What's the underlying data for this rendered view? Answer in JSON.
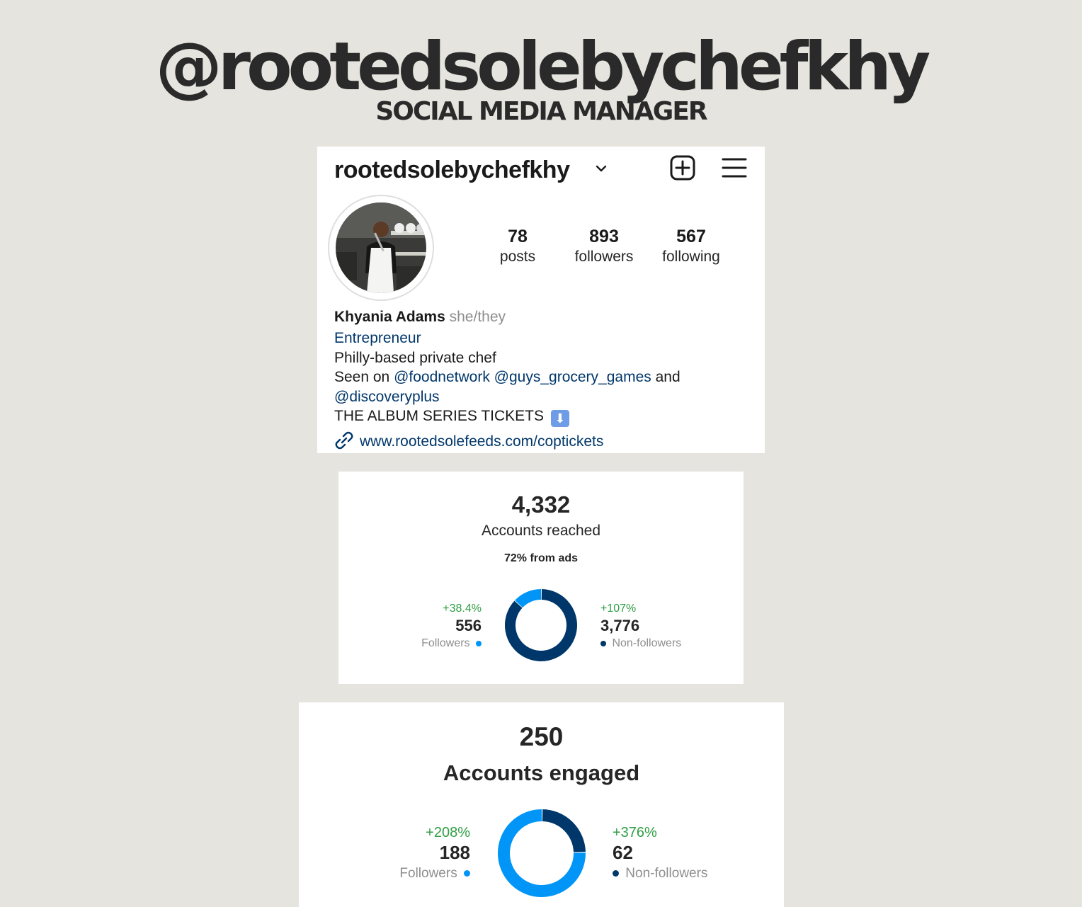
{
  "header": {
    "title": "@rootedsolebychefkhy",
    "subtitle": "SOCIAL MEDIA MANAGER"
  },
  "profile": {
    "username": "rootedsolebychefkhy",
    "icons": {
      "dropdown": "chevron-down-icon",
      "add": "add-post-icon",
      "menu": "hamburger-menu-icon"
    },
    "stats": [
      {
        "value": "78",
        "label": "posts"
      },
      {
        "value": "893",
        "label": "followers"
      },
      {
        "value": "567",
        "label": "following"
      }
    ],
    "name": "Khyania Adams",
    "pronouns": "she/they",
    "category": "Entrepreneur",
    "bio_line1": "Philly-based private chef",
    "bio_seen_prefix": "Seen on",
    "bio_tag1": "@foodnetwork",
    "bio_tag2": "@guys_grocery_games",
    "bio_and": "and",
    "bio_tag3": "@discoveryplus",
    "bio_album": "THE ALBUM SERIES TICKETS",
    "link": "www.rootedsolefeeds.com/coptickets"
  },
  "reach": {
    "total": "4,332",
    "label": "Accounts reached",
    "ads_note": "72% from ads",
    "followers": {
      "change": "+38.4%",
      "value": "556",
      "label": "Followers"
    },
    "non_followers": {
      "change": "+107%",
      "value": "3,776",
      "label": "Non-followers"
    },
    "colors": {
      "followers": "#0095f6",
      "non_followers": "#00376b"
    }
  },
  "engaged": {
    "total": "250",
    "label": "Accounts engaged",
    "followers": {
      "change": "+208%",
      "value": "188",
      "label": "Followers"
    },
    "non_followers": {
      "change": "+376%",
      "value": "62",
      "label": "Non-followers"
    },
    "colors": {
      "followers": "#0095f6",
      "non_followers": "#00376b"
    }
  }
}
